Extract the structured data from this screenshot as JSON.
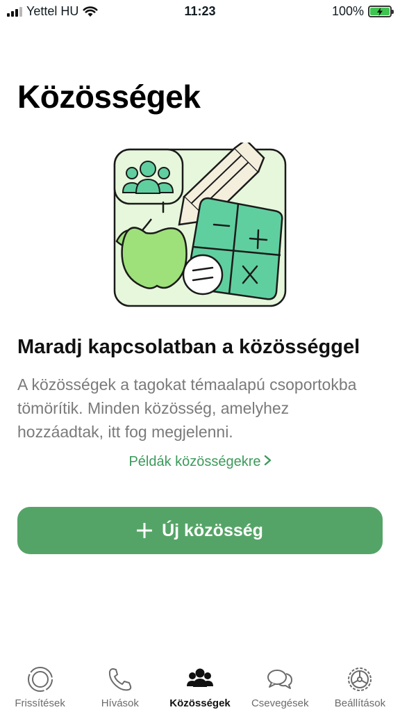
{
  "status_bar": {
    "carrier": "Yettel HU",
    "time": "11:23",
    "battery": "100%"
  },
  "page": {
    "title": "Közösségek"
  },
  "empty_state": {
    "headline": "Maradj kapcsolatban a közösséggel",
    "description": "A közösségek a tagokat témaalapú csoportokba tömörítik. Minden közösség, amelyhez hozzáadtak, itt fog megjelenni.",
    "examples_link": "Példák közösségekre",
    "new_button": "Új közösség"
  },
  "tabs": [
    {
      "label": "Frissítések",
      "icon": "updates-icon",
      "active": false
    },
    {
      "label": "Hívások",
      "icon": "phone-icon",
      "active": false
    },
    {
      "label": "Közösségek",
      "icon": "communities-icon",
      "active": true
    },
    {
      "label": "Csevegések",
      "icon": "chats-icon",
      "active": false
    },
    {
      "label": "Beállítások",
      "icon": "settings-icon",
      "active": false
    }
  ],
  "colors": {
    "accent": "#55a467",
    "link": "#3b9a5a",
    "illustration_bg": "#e6f7dc",
    "illustration_green": "#60cf9f",
    "apple": "#9ee07a"
  }
}
